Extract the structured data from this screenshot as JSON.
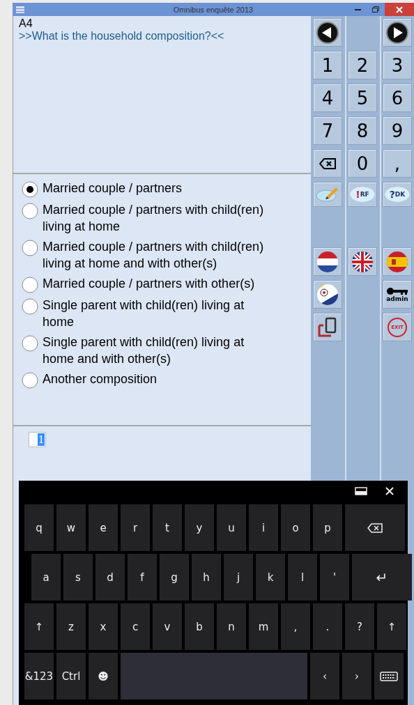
{
  "window": {
    "title": "Omnibus enquête 2013"
  },
  "question": {
    "code": "A4",
    "text": ">>What is the household composition?<<"
  },
  "options": [
    {
      "label": "Married couple / partners",
      "selected": true
    },
    {
      "label": "Married couple / partners with child(ren) living at home",
      "selected": false
    },
    {
      "label": "Married couple / partners with child(ren) living at home and with other(s)",
      "selected": false
    },
    {
      "label": "Married couple / partners with other(s)",
      "selected": false
    },
    {
      "label": "Single parent with child(ren) living at home",
      "selected": false
    },
    {
      "label": "Single parent with child(ren) living at home and with other(s)",
      "selected": false
    },
    {
      "label": "Another composition",
      "selected": false
    }
  ],
  "answer": {
    "value": "1"
  },
  "keypad": [
    [
      {
        "kind": "prev"
      },
      {
        "kind": "empty"
      },
      {
        "kind": "next"
      }
    ],
    [
      {
        "kind": "digit",
        "label": "1"
      },
      {
        "kind": "digit",
        "label": "2"
      },
      {
        "kind": "digit",
        "label": "3"
      }
    ],
    [
      {
        "kind": "digit",
        "label": "4"
      },
      {
        "kind": "digit",
        "label": "5"
      },
      {
        "kind": "digit",
        "label": "6"
      }
    ],
    [
      {
        "kind": "digit",
        "label": "7"
      },
      {
        "kind": "digit",
        "label": "8"
      },
      {
        "kind": "digit",
        "label": "9"
      }
    ],
    [
      {
        "kind": "backspace"
      },
      {
        "kind": "digit",
        "label": "0"
      },
      {
        "kind": "digit",
        "label": ","
      }
    ],
    [
      {
        "kind": "pencil"
      },
      {
        "kind": "bubble",
        "label": "RF",
        "mark": "!"
      },
      {
        "kind": "bubble",
        "label": "DK",
        "mark": "?"
      }
    ]
  ],
  "extras": [
    [
      {
        "kind": "flag-nl"
      },
      {
        "kind": "flag-uk"
      },
      {
        "kind": "flag-es"
      }
    ],
    [
      {
        "kind": "flag-bq"
      },
      {
        "kind": "empty"
      },
      {
        "kind": "admin",
        "label": "admin"
      }
    ],
    [
      {
        "kind": "device"
      },
      {
        "kind": "empty"
      },
      {
        "kind": "exit",
        "label": "EXIT"
      }
    ]
  ],
  "keyboard": {
    "rows": [
      [
        {
          "kind": "key",
          "label": "q"
        },
        {
          "kind": "key",
          "label": "w"
        },
        {
          "kind": "key",
          "label": "e"
        },
        {
          "kind": "key",
          "label": "r"
        },
        {
          "kind": "key",
          "label": "t"
        },
        {
          "kind": "key",
          "label": "y"
        },
        {
          "kind": "key",
          "label": "u"
        },
        {
          "kind": "key",
          "label": "i"
        },
        {
          "kind": "key",
          "label": "o"
        },
        {
          "kind": "key",
          "label": "p"
        },
        {
          "kind": "backspace"
        }
      ],
      [
        {
          "kind": "key",
          "label": "a"
        },
        {
          "kind": "key",
          "label": "s"
        },
        {
          "kind": "key",
          "label": "d"
        },
        {
          "kind": "key",
          "label": "f"
        },
        {
          "kind": "key",
          "label": "g"
        },
        {
          "kind": "key",
          "label": "h"
        },
        {
          "kind": "key",
          "label": "j"
        },
        {
          "kind": "key",
          "label": "k"
        },
        {
          "kind": "key",
          "label": "l"
        },
        {
          "kind": "key",
          "label": "'"
        },
        {
          "kind": "wide",
          "label": "↵"
        }
      ],
      [
        {
          "kind": "key",
          "label": "↑"
        },
        {
          "kind": "key",
          "label": "z"
        },
        {
          "kind": "key",
          "label": "x"
        },
        {
          "kind": "key",
          "label": "c"
        },
        {
          "kind": "key",
          "label": "v"
        },
        {
          "kind": "key",
          "label": "b"
        },
        {
          "kind": "key",
          "label": "n"
        },
        {
          "kind": "key",
          "label": "m"
        },
        {
          "kind": "key",
          "label": ","
        },
        {
          "kind": "key",
          "label": "."
        },
        {
          "kind": "key",
          "label": "?"
        },
        {
          "kind": "key",
          "label": "↑"
        }
      ],
      [
        {
          "kind": "key",
          "label": "&123"
        },
        {
          "kind": "key",
          "label": "Ctrl"
        },
        {
          "kind": "key",
          "label": "☻"
        },
        {
          "kind": "space"
        },
        {
          "kind": "key",
          "label": "‹"
        },
        {
          "kind": "key",
          "label": "›"
        },
        {
          "kind": "keyboard"
        }
      ]
    ]
  }
}
